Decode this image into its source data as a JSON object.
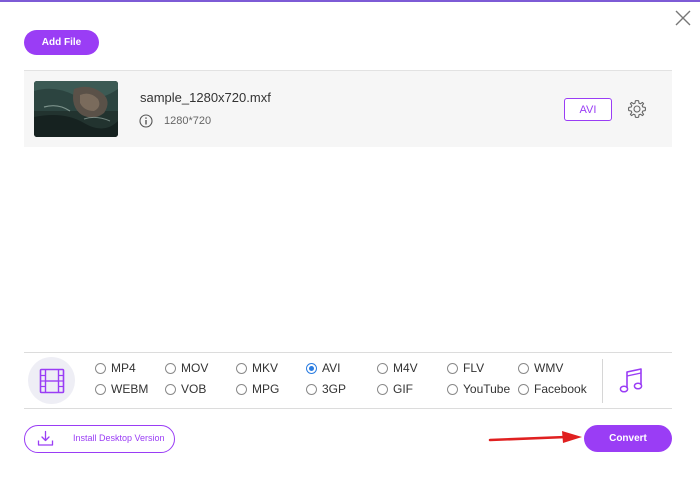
{
  "toolbar": {
    "add_file_label": "Add File"
  },
  "file": {
    "name": "sample_1280x720.mxf",
    "resolution": "1280*720",
    "output_format": "AVI"
  },
  "formats": {
    "selected": "AVI",
    "row1": [
      "MP4",
      "MOV",
      "MKV",
      "AVI",
      "M4V",
      "FLV",
      "WMV"
    ],
    "row2": [
      "WEBM",
      "VOB",
      "MPG",
      "3GP",
      "GIF",
      "YouTube",
      "Facebook"
    ]
  },
  "footer": {
    "install_label": "Install Desktop Version",
    "convert_label": "Convert"
  },
  "colors": {
    "accent": "#9a3df5",
    "radio_selected": "#2b7de1",
    "annotation_arrow": "#e02020"
  },
  "icons": {
    "close": "close-icon",
    "info": "info-icon",
    "settings": "gear-icon",
    "video_tab": "film-icon",
    "audio_tab": "music-note-icon",
    "install": "download-icon"
  }
}
